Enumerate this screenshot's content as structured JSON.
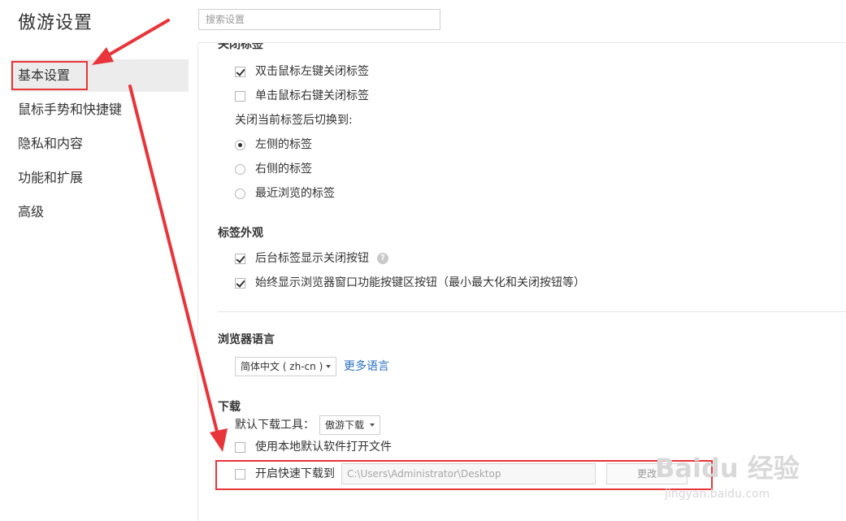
{
  "window": {
    "title": "傲游设置"
  },
  "search": {
    "placeholder": "搜索设置"
  },
  "sidebar": {
    "items": [
      {
        "label": "基本设置",
        "active": true
      },
      {
        "label": "鼠标手势和快捷键"
      },
      {
        "label": "隐私和内容"
      },
      {
        "label": "功能和扩展"
      },
      {
        "label": "高级"
      }
    ]
  },
  "close_tabs": {
    "title": "关闭标签",
    "double_click_left": {
      "label": "双击鼠标左键关闭标签",
      "checked": true
    },
    "single_click_right": {
      "label": "单击鼠标右键关闭标签",
      "checked": false
    },
    "after_close_label": "关闭当前标签后切换到:",
    "options": [
      {
        "label": "左侧的标签",
        "selected": true
      },
      {
        "label": "右侧的标签",
        "selected": false
      },
      {
        "label": "最近浏览的标签",
        "selected": false
      }
    ]
  },
  "tab_appearance": {
    "title": "标签外观",
    "show_close_button": {
      "label": "后台标签显示关闭按钮",
      "checked": true,
      "help_icon": "question-icon"
    },
    "always_show_buttons": {
      "label": "始终显示浏览器窗口功能按键区按钮（最小最大化和关闭按钮等）",
      "checked": true
    }
  },
  "language": {
    "title": "浏览器语言",
    "selected": "简体中文 ( zh-cn )",
    "more_link": "更多语言"
  },
  "download": {
    "title": "下载",
    "default_tool_label": "默认下载工具：",
    "default_tool_value": "傲游下载",
    "use_local_default": {
      "label": "使用本地默认软件打开文件",
      "checked": false
    },
    "quick_download": {
      "label": "开启快速下载到",
      "checked": false
    },
    "path": "C:\\Users\\Administrator\\Desktop",
    "change_button": "更改"
  },
  "watermark": {
    "logo": "Baidu 经验",
    "url": "jingyan.baidu.com"
  },
  "colors": {
    "accent_link": "#2a6fc4",
    "annotation_red": "#e8353a",
    "active_nav_bg": "#ececec"
  }
}
